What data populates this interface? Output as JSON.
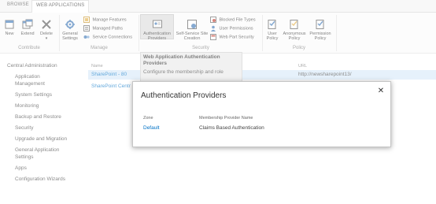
{
  "tabs": [
    {
      "label": "BROWSE"
    },
    {
      "label": "WEB APPLICATIONS"
    }
  ],
  "ribbon": {
    "contribute": {
      "label": "Contribute",
      "new": "New",
      "extend": "Extend",
      "delete": "Delete"
    },
    "manage": {
      "label": "Manage",
      "general_settings_1": "General",
      "general_settings_2": "Settings",
      "manage_features": "Manage Features",
      "managed_paths": "Managed Paths",
      "service_connections": "Service Connections"
    },
    "security": {
      "label": "Security",
      "auth_providers_1": "Authentication",
      "auth_providers_2": "Providers",
      "self_service_1": "Self-Service Site",
      "self_service_2": "Creation",
      "blocked_file_types": "Blocked File Types",
      "user_permissions": "User Permissions",
      "web_part_security": "Web Part Security"
    },
    "policy": {
      "label": "Policy",
      "user_policy_1": "User",
      "user_policy_2": "Policy",
      "anonymous_policy_1": "Anonymous",
      "anonymous_policy_2": "Policy",
      "permission_policy_1": "Permission",
      "permission_policy_2": "Policy"
    }
  },
  "tooltip": {
    "title_1": "Web Application Authentication",
    "title_2": "Providers",
    "body": "Configure the membership and role"
  },
  "leftnav": {
    "items": [
      {
        "label": "Central Administration"
      },
      {
        "label": "Application"
      },
      {
        "label": "Management"
      },
      {
        "label": "System Settings"
      },
      {
        "label": "Monitoring"
      },
      {
        "label": "Backup and Restore"
      },
      {
        "label": "Security"
      },
      {
        "label": "Upgrade and Migration"
      },
      {
        "label": "General Application"
      },
      {
        "label": "Settings"
      },
      {
        "label": "Apps"
      },
      {
        "label": "Configuration Wizards"
      }
    ]
  },
  "list": {
    "headers": {
      "name": "Name",
      "url": "URL"
    },
    "rows": [
      {
        "name": "SharePoint - 80",
        "url": "http://newsharepoint13/"
      },
      {
        "name": "SharePoint Centr",
        "url": ""
      }
    ]
  },
  "dialog": {
    "title": "Authentication Providers",
    "close": "✕",
    "headers": {
      "zone": "Zone",
      "provider": "Membership Provider Name"
    },
    "rows": [
      {
        "zone": "Default",
        "provider": "Claims Based Authentication"
      }
    ]
  },
  "colors": {
    "accent": "#0072c6",
    "selected_row": "#d7e9f8"
  }
}
